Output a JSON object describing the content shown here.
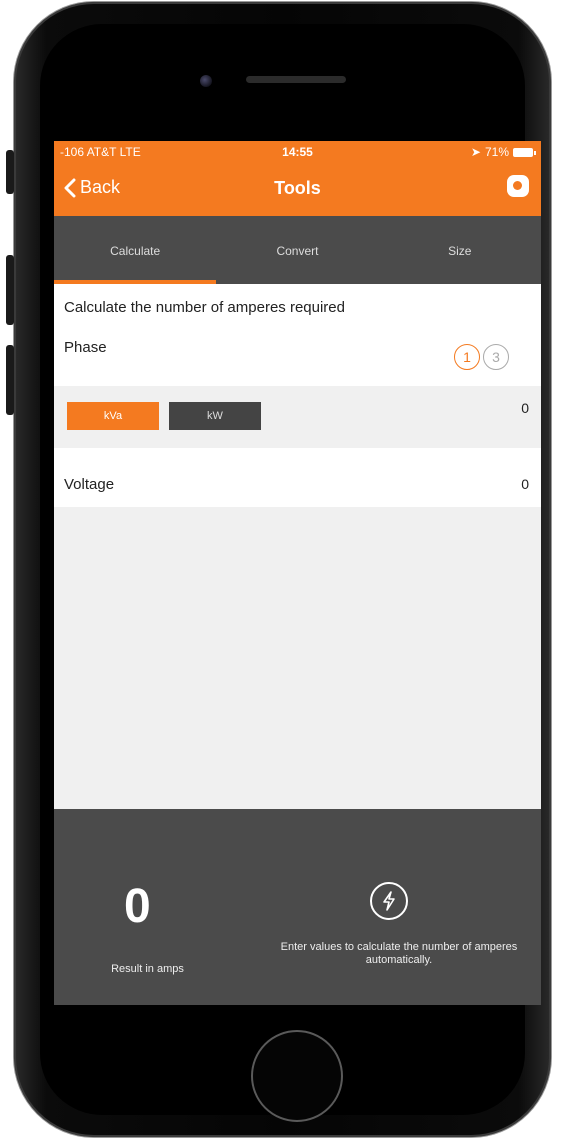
{
  "status_bar": {
    "carrier": "-106 AT&T  LTE",
    "time": "14:55",
    "battery": "71%"
  },
  "nav": {
    "back_label": "Back",
    "title": "Tools"
  },
  "tabs": [
    {
      "label": "Calculate",
      "active": true
    },
    {
      "label": "Convert",
      "active": false
    },
    {
      "label": "Size",
      "active": false
    }
  ],
  "form": {
    "heading": "Calculate the number of amperes required",
    "phase_label": "Phase",
    "phase_options": [
      "1",
      "3"
    ],
    "phase_selected": "1",
    "power_units": [
      "kVa",
      "kW"
    ],
    "power_unit_selected": "kVa",
    "power_value": "0",
    "voltage_label": "Voltage",
    "voltage_value": "0"
  },
  "result": {
    "value": "0",
    "label": "Result in amps",
    "hint": "Enter values to calculate the number of amperes automatically."
  },
  "colors": {
    "accent": "#f47a20",
    "dark_panel": "#4b4b4b"
  }
}
